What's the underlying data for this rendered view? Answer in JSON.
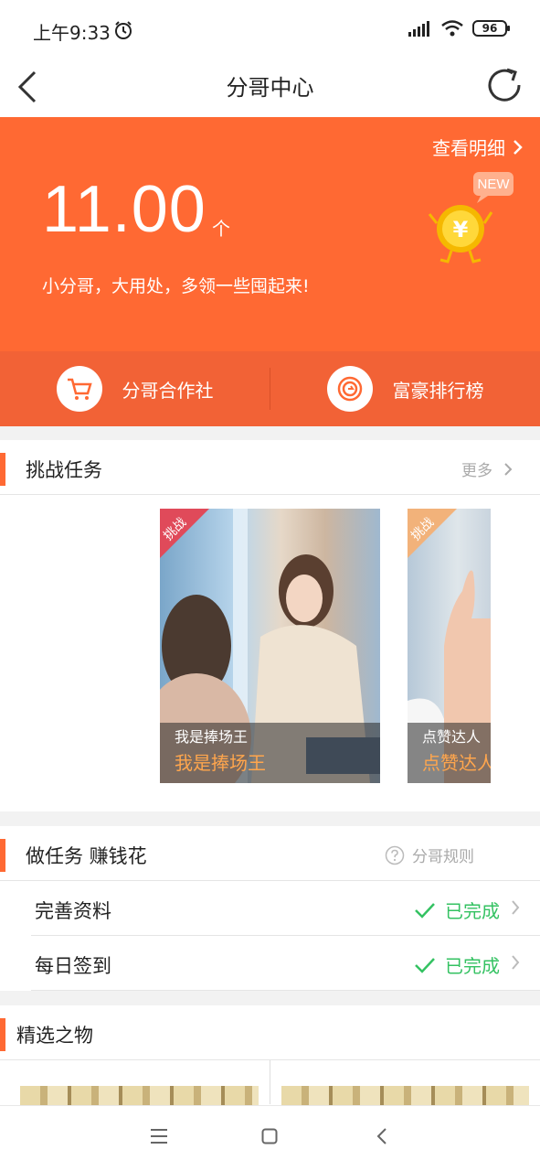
{
  "status_bar": {
    "time": "上午9:33",
    "battery": "96"
  },
  "nav": {
    "title": "分哥中心"
  },
  "hero": {
    "detail_link": "查看明细",
    "amount": "11.00",
    "unit": "个",
    "slogan": "小分哥，大用处，多领一些囤起来!",
    "badge": "NEW"
  },
  "hero_actions": [
    {
      "label": "分哥合作社",
      "icon": "cart-icon"
    },
    {
      "label": "富豪排行榜",
      "icon": "coin-ring-icon"
    }
  ],
  "challenge": {
    "title": "挑战任务",
    "more": "更多",
    "cards": [
      {
        "tag": "挑战",
        "caption": "我是捧场王",
        "caption_big": "我是捧场王",
        "tag_color": "#e04a5a"
      },
      {
        "tag": "挑战",
        "caption": "点赞达人",
        "caption_big": "点赞达人",
        "tag_color": "#f2b27a"
      }
    ]
  },
  "tasks": {
    "title": "做任务 赚钱花",
    "rules": "分哥规则",
    "items": [
      {
        "name": "完善资料",
        "status": "已完成"
      },
      {
        "name": "每日签到",
        "status": "已完成"
      }
    ]
  },
  "selected": {
    "title": "精选之物"
  },
  "colors": {
    "accent": "#ff6933",
    "success": "#34c262"
  }
}
